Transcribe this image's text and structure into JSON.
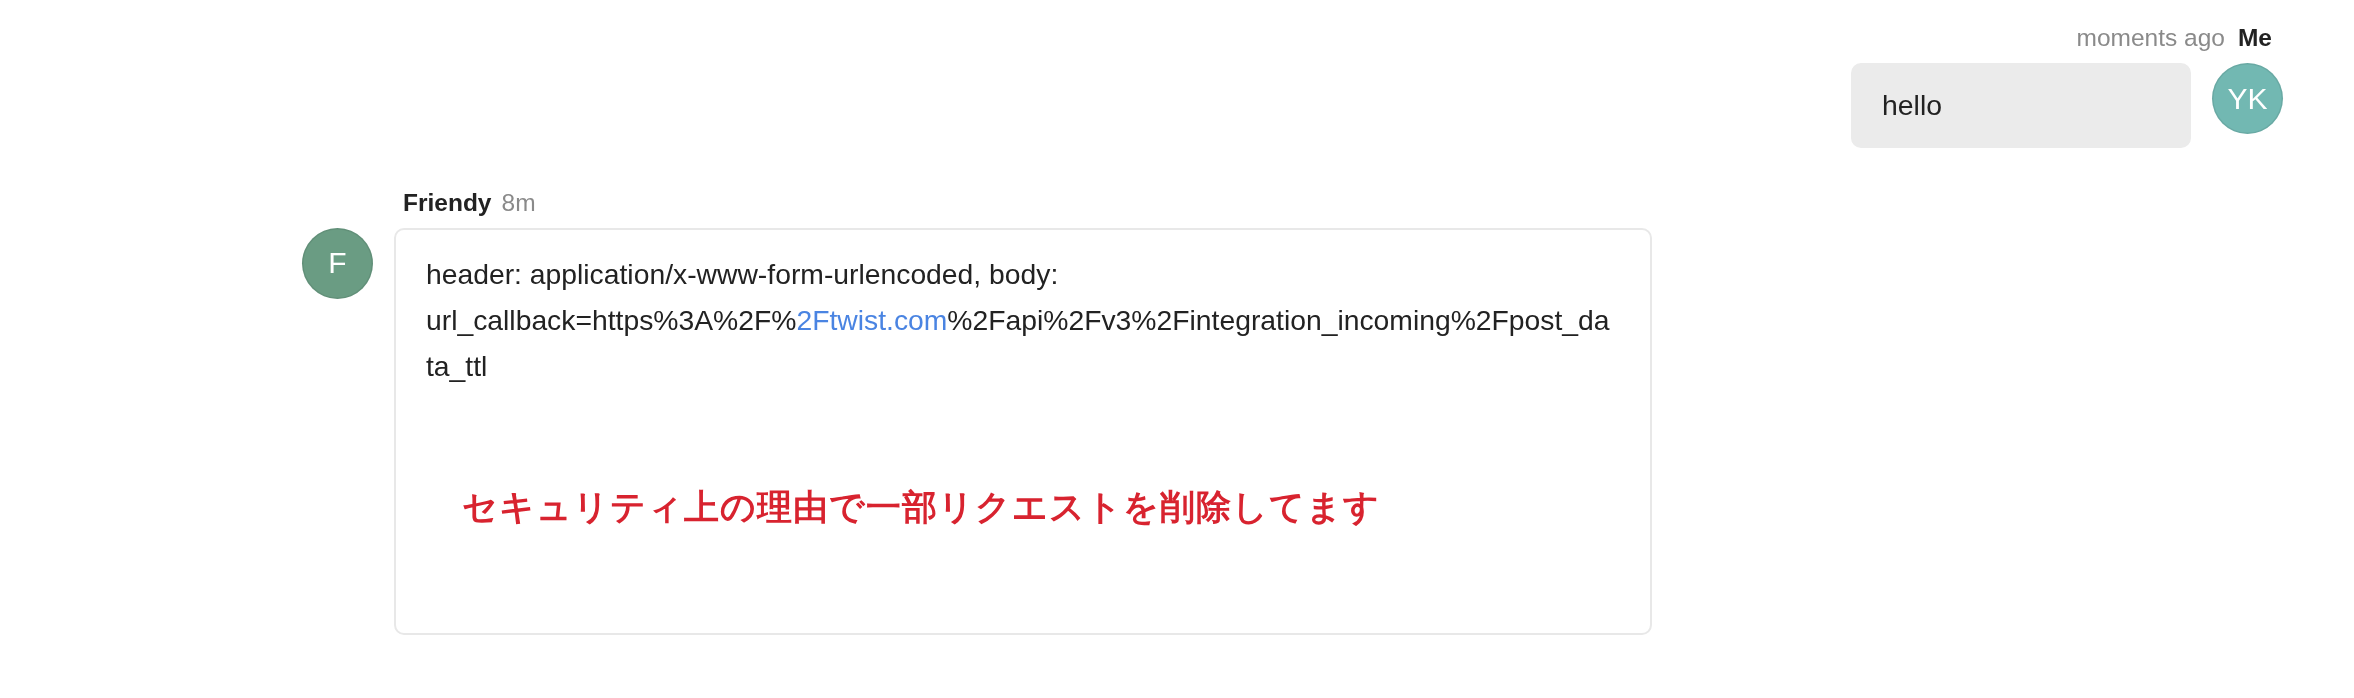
{
  "messages": [
    {
      "kind": "outgoing",
      "sender": "Me",
      "time": "moments ago",
      "avatar": {
        "initials": "YK",
        "color": "#72b8b2"
      },
      "text": "hello"
    },
    {
      "kind": "incoming",
      "sender": "Friendy",
      "time": "8m",
      "avatar": {
        "initials": "F",
        "color": "#6a9c83"
      },
      "body_lines": [
        [
          {
            "kind": "text",
            "text": "header: application/x-www-form-urlencoded, body:"
          }
        ],
        [
          {
            "kind": "text",
            "text": "url_callback=https%3A%2F%"
          },
          {
            "kind": "link",
            "text": "2Ftwist.com"
          },
          {
            "kind": "text",
            "text": "%2Fapi%2Fv3%2Fintegration_incoming%2Fpost_da"
          }
        ],
        [
          {
            "kind": "text",
            "text": "ta_ttl"
          }
        ]
      ],
      "note": "セキュリティ上の理由で一部リクエストを削除してます"
    }
  ]
}
